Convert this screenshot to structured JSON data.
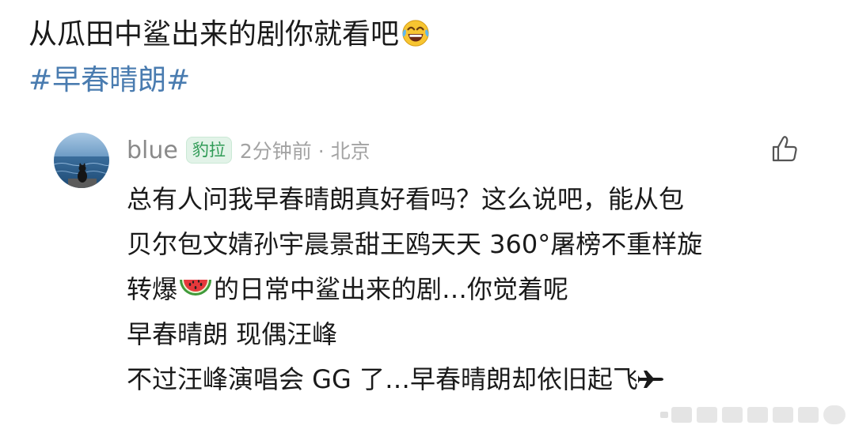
{
  "post": {
    "title": "从瓜田中鲨出来的剧你就看吧",
    "title_emoji": "laughing-tears-icon",
    "hashtag": "#早春晴朗#"
  },
  "comment": {
    "username": "blue",
    "badge": "豹拉",
    "meta": "2分钟前 · 北京",
    "lines": {
      "l1": "总有人问我早春晴朗真好看吗？这么说吧，能从包",
      "l2": "贝尔包文婧孙宇晨景甜王鸥天天 360°屠榜不重样旋",
      "l3a": "转爆",
      "l3b": "的日常中鲨出来的剧…你觉着呢",
      "l4": "早春晴朗  现偶汪峰",
      "l5": "不过汪峰演唱会 GG 了…早春晴朗却依旧起飞"
    },
    "inline_icons": [
      "watermelon-icon",
      "airplane-icon"
    ]
  },
  "icons": {
    "like": "thumbs-up-icon",
    "avatar": "avatar-cat-sea"
  },
  "colors": {
    "hashtag": "#4a7cb0",
    "badge_text": "#2f9b56",
    "badge_bg": "#e2f3e8",
    "meta": "#a3a3a3",
    "username": "#8a8a8a"
  }
}
